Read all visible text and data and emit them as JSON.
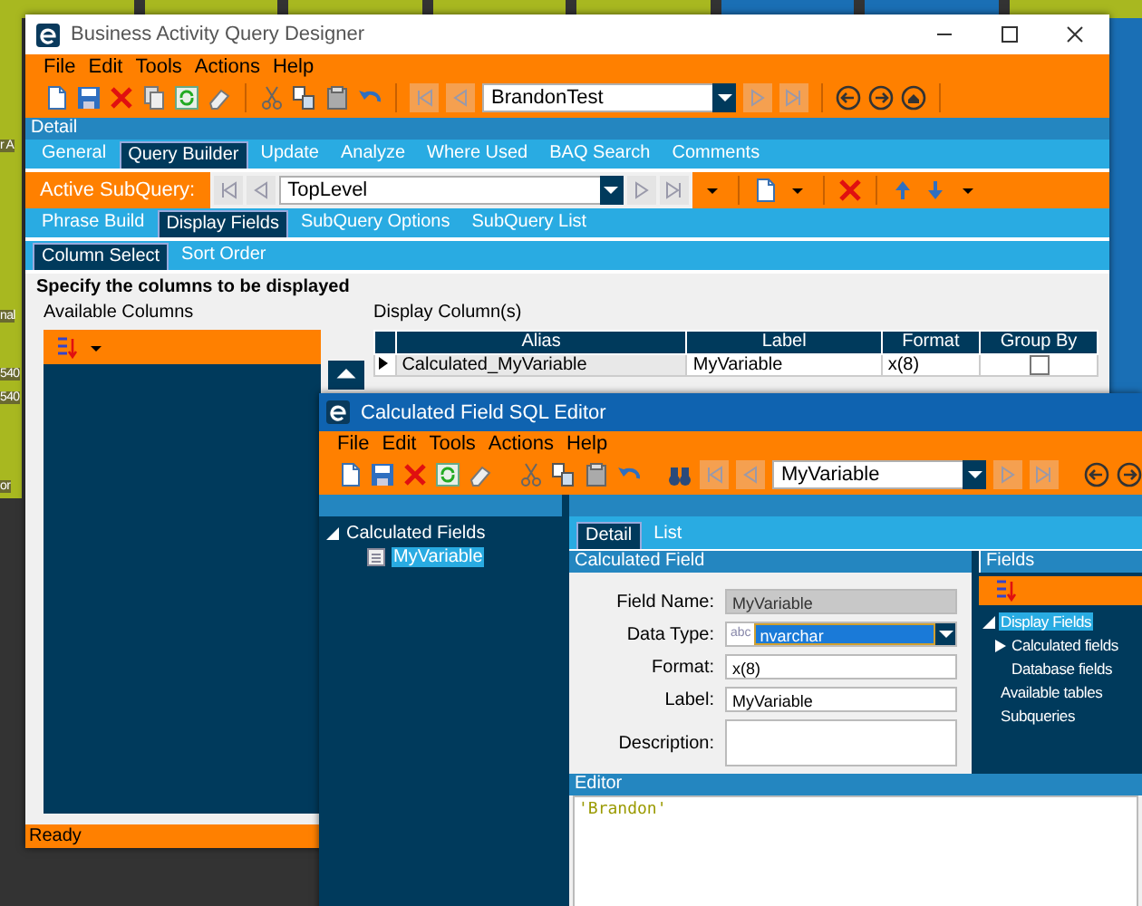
{
  "desktop": {
    "fragments": [
      "r A",
      "nal",
      "540",
      "540",
      "or"
    ]
  },
  "main_window": {
    "title": "Business Activity Query Designer",
    "menu": [
      "File",
      "Edit",
      "Tools",
      "Actions",
      "Help"
    ],
    "record": "BrandonTest",
    "section": "Detail",
    "tabs": [
      {
        "label": "General",
        "selected": false
      },
      {
        "label": "Query Builder",
        "selected": true
      },
      {
        "label": "Update",
        "selected": false
      },
      {
        "label": "Analyze",
        "selected": false
      },
      {
        "label": "Where Used",
        "selected": false
      },
      {
        "label": "BAQ Search",
        "selected": false
      },
      {
        "label": "Comments",
        "selected": false
      }
    ],
    "subquery": {
      "label": "Active SubQuery:",
      "value": "TopLevel"
    },
    "subtabs": [
      {
        "label": "Phrase Build",
        "selected": false
      },
      {
        "label": "Display Fields",
        "selected": true
      },
      {
        "label": "SubQuery Options",
        "selected": false
      },
      {
        "label": "SubQuery List",
        "selected": false
      }
    ],
    "column_tabs": [
      {
        "label": "Column Select",
        "selected": true
      },
      {
        "label": "Sort Order",
        "selected": false
      }
    ],
    "instruction": "Specify the columns to be displayed",
    "available_label": "Available Columns",
    "display_label": "Display Column(s)",
    "table": {
      "columns": [
        "Alias",
        "Label",
        "Format",
        "Group By"
      ],
      "rows": [
        {
          "alias": "Calculated_MyVariable",
          "label": "MyVariable",
          "format": "x(8)",
          "group_by": false
        }
      ]
    },
    "status": "Ready"
  },
  "editor_window": {
    "title": "Calculated Field SQL Editor",
    "menu": [
      "File",
      "Edit",
      "Tools",
      "Actions",
      "Help"
    ],
    "record": "MyVariable",
    "tree": [
      {
        "label": "Calculated Fields",
        "expanded": true,
        "children": [
          {
            "label": "MyVariable",
            "selected": true
          }
        ]
      }
    ],
    "tabs": [
      {
        "label": "Detail",
        "selected": true
      },
      {
        "label": "List",
        "selected": false
      }
    ],
    "form_title": "Calculated Field",
    "form": [
      {
        "kind": "readonly",
        "label": "Field Name:",
        "value": "MyVariable"
      },
      {
        "kind": "dropdown",
        "label": "Data Type:",
        "badge": "abc",
        "value": "nvarchar"
      },
      {
        "kind": "text",
        "label": "Format:",
        "value": "x(8)"
      },
      {
        "kind": "text",
        "label": "Label:",
        "value": "MyVariable"
      },
      {
        "kind": "textarea",
        "label": "Description:"
      }
    ],
    "fields_title": "Fields",
    "fields_tree": [
      {
        "label": "Display Fields",
        "selected": true,
        "expanded": true,
        "children": [
          {
            "label": "Calculated fields",
            "selected": false,
            "expanded": false
          },
          {
            "label": "Database fields",
            "selected": false
          }
        ]
      },
      {
        "label": "Available tables",
        "selected": false
      },
      {
        "label": "Subqueries",
        "selected": false
      }
    ],
    "editor_label": "Editor",
    "code": "'Brandon'"
  }
}
